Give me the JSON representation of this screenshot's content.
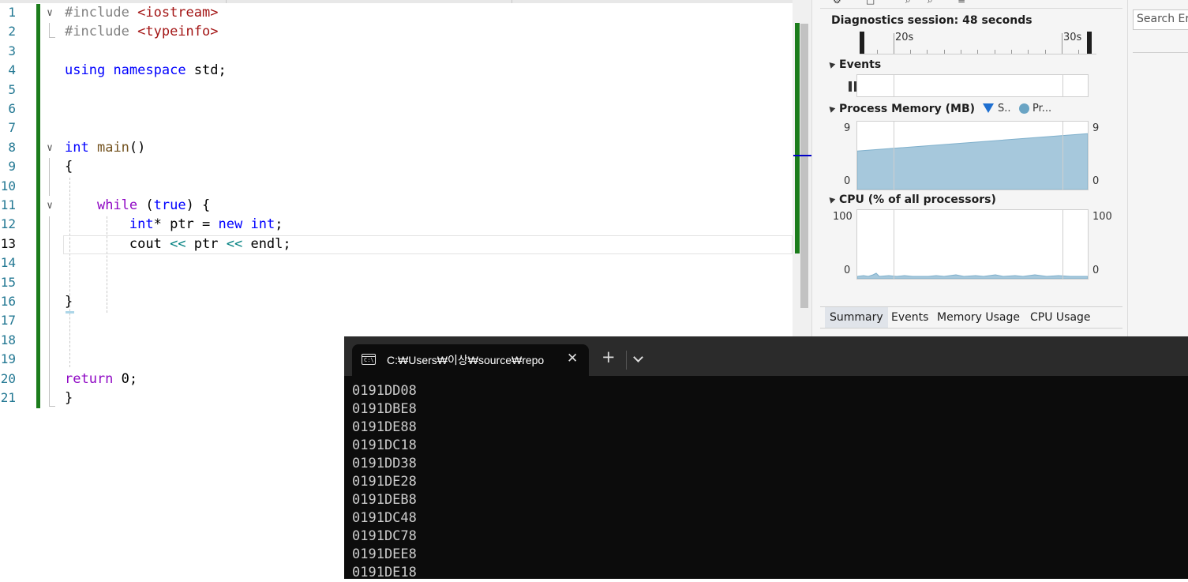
{
  "editor": {
    "line_numbers": [
      "1",
      "2",
      "3",
      "4",
      "5",
      "6",
      "7",
      "8",
      "9",
      "10",
      "11",
      "12",
      "13",
      "14",
      "15",
      "16",
      "17",
      "18",
      "19",
      "20",
      "21"
    ],
    "current_line": "13",
    "lines": [
      {
        "n": "1",
        "tokens": [
          {
            "t": "#include ",
            "c": "pp"
          },
          {
            "t": "<iostream>",
            "c": "inc"
          }
        ]
      },
      {
        "n": "2",
        "tokens": [
          {
            "t": "#include ",
            "c": "pp"
          },
          {
            "t": "<typeinfo>",
            "c": "inc"
          }
        ]
      },
      {
        "n": "3",
        "tokens": []
      },
      {
        "n": "4",
        "tokens": [
          {
            "t": "using",
            "c": "kw"
          },
          {
            "t": " ",
            "c": ""
          },
          {
            "t": "namespace",
            "c": "kw"
          },
          {
            "t": " std;",
            "c": ""
          }
        ]
      },
      {
        "n": "5",
        "tokens": []
      },
      {
        "n": "6",
        "tokens": []
      },
      {
        "n": "7",
        "tokens": []
      },
      {
        "n": "8",
        "tokens": [
          {
            "t": "int",
            "c": "kw"
          },
          {
            "t": " ",
            "c": ""
          },
          {
            "t": "main",
            "c": "fn"
          },
          {
            "t": "()",
            "c": ""
          }
        ]
      },
      {
        "n": "9",
        "tokens": [
          {
            "t": "{",
            "c": ""
          }
        ]
      },
      {
        "n": "10",
        "tokens": []
      },
      {
        "n": "11",
        "tokens": [
          {
            "t": "    ",
            "c": ""
          },
          {
            "t": "while",
            "c": "kw2"
          },
          {
            "t": " (",
            "c": ""
          },
          {
            "t": "true",
            "c": "kw"
          },
          {
            "t": ") {",
            "c": ""
          }
        ]
      },
      {
        "n": "12",
        "tokens": [
          {
            "t": "        ",
            "c": ""
          },
          {
            "t": "int",
            "c": "kw"
          },
          {
            "t": "* ptr = ",
            "c": ""
          },
          {
            "t": "new",
            "c": "kw"
          },
          {
            "t": " ",
            "c": ""
          },
          {
            "t": "int",
            "c": "kw"
          },
          {
            "t": ";",
            "c": ""
          }
        ]
      },
      {
        "n": "13",
        "tokens": [
          {
            "t": "        cout ",
            "c": ""
          },
          {
            "t": "<<",
            "c": "op"
          },
          {
            "t": " ptr ",
            "c": ""
          },
          {
            "t": "<<",
            "c": "op"
          },
          {
            "t": " endl;",
            "c": ""
          }
        ]
      },
      {
        "n": "14",
        "tokens": []
      },
      {
        "n": "15",
        "tokens": []
      },
      {
        "n": "16",
        "tokens": [
          {
            "t": "}",
            "c": ""
          }
        ]
      },
      {
        "n": "17",
        "tokens": []
      },
      {
        "n": "18",
        "tokens": []
      },
      {
        "n": "19",
        "tokens": []
      },
      {
        "n": "20",
        "tokens": [
          {
            "t": "return",
            "c": "kw2"
          },
          {
            "t": " 0;",
            "c": ""
          }
        ]
      },
      {
        "n": "21",
        "tokens": [
          {
            "t": "}",
            "c": ""
          }
        ]
      }
    ],
    "colors": {
      "keyword": "#0000ff",
      "preprocessor": "#808080",
      "include": "#a31515",
      "function": "#74531f",
      "control": "#8f08c4",
      "operator": "#008080",
      "change_bar": "#1b7c1b"
    }
  },
  "diagnostics": {
    "session_label": "Diagnostics session: 48 seconds",
    "ruler_labels": [
      "20s",
      "30s"
    ],
    "events_header": "Events",
    "memory_header": "Process Memory (MB)",
    "memory_legend": [
      {
        "icon": "triangle-marker",
        "label": "S.."
      },
      {
        "icon": "dot-marker",
        "label": "Pr..."
      }
    ],
    "memory_axis": {
      "top_left": "9",
      "bottom_left": "0",
      "top_right": "9",
      "bottom_right": "0"
    },
    "memory_chart": {
      "type": "area",
      "ylim": [
        0,
        9
      ],
      "y_start": 5.1,
      "y_end": 7.4,
      "color": "#a6c8dc"
    },
    "cpu_header": "CPU (% of all processors)",
    "cpu_axis": {
      "top_left": "100",
      "bottom_left": "0",
      "top_right": "100",
      "bottom_right": "0"
    },
    "tabs": [
      "Summary",
      "Events",
      "Memory Usage",
      "CPU Usage"
    ],
    "active_tab": "Summary"
  },
  "search": {
    "placeholder": "Search Er"
  },
  "terminal": {
    "tab_title": "C:₩Users₩이상₩source₩repo",
    "icon_text": "C:\\",
    "output_lines": [
      "0191DD08",
      "0191DBE8",
      "0191DE88",
      "0191DC18",
      "0191DD38",
      "0191DE28",
      "0191DEB8",
      "0191DC48",
      "0191DC78",
      "0191DEE8",
      "0191DE18"
    ]
  }
}
